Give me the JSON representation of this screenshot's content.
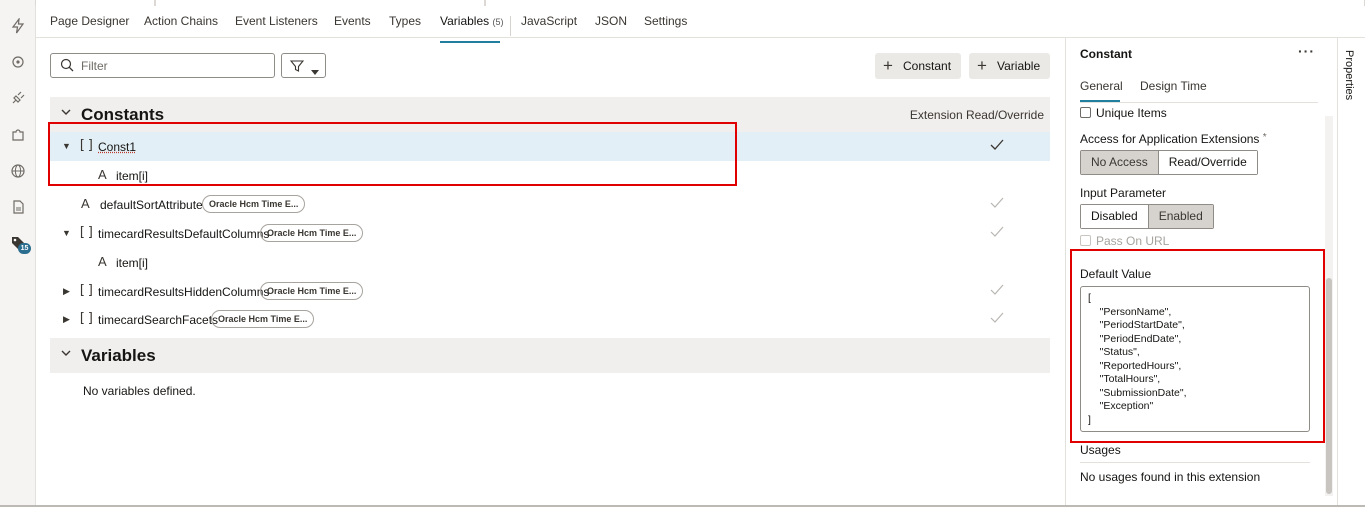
{
  "tabs": [
    {
      "label": "Page Designer"
    },
    {
      "label": "Action Chains"
    },
    {
      "label": "Event Listeners"
    },
    {
      "label": "Events"
    },
    {
      "label": "Types"
    },
    {
      "label": "Variables",
      "count": "(5)"
    },
    {
      "label": "JavaScript"
    },
    {
      "label": "JSON"
    },
    {
      "label": "Settings"
    }
  ],
  "toolbar": {
    "filter_placeholder": "Filter",
    "constant_button": "Constant",
    "variable_button": "Variable"
  },
  "constants_section": {
    "title": "Constants",
    "column_header": "Extension Read/Override",
    "rows": [
      {
        "name": "Const1",
        "type_icon": "array-icon",
        "expanded": true,
        "checked": true
      },
      {
        "name": "item[i]",
        "type_icon": "string-icon"
      },
      {
        "name": "defaultSortAttribute",
        "type_icon": "string-icon",
        "pill": "Oracle Hcm Time E...",
        "checked": true
      },
      {
        "name": "timecardResultsDefaultColumns",
        "type_icon": "array-icon",
        "expanded": true,
        "pill": "Oracle Hcm Time E...",
        "checked": true
      },
      {
        "name": "item[i]",
        "type_icon": "string-icon"
      },
      {
        "name": "timecardResultsHiddenColumns",
        "type_icon": "array-icon",
        "expanded": false,
        "pill": "Oracle Hcm Time E...",
        "checked": true
      },
      {
        "name": "timecardSearchFacets",
        "type_icon": "array-icon",
        "expanded": false,
        "pill": "Oracle Hcm Time E...",
        "checked": true
      }
    ]
  },
  "variables_section": {
    "title": "Variables",
    "empty_text": "No variables defined."
  },
  "properties": {
    "title": "Constant",
    "more": "···",
    "tabs": [
      "General",
      "Design Time"
    ],
    "unique_items_label": "Unique Items",
    "access_label": "Access for Application Extensions",
    "required_mark": "*",
    "access_options": [
      "No Access",
      "Read/Override"
    ],
    "access_selected": "No Access",
    "input_param_label": "Input Parameter",
    "input_param_options": [
      "Disabled",
      "Enabled"
    ],
    "input_param_selected": "Enabled",
    "pass_on_url_label": "Pass On URL",
    "default_value_label": "Default Value",
    "default_value_lines": [
      "[",
      "    \"PersonName\",",
      "    \"PeriodStartDate\",",
      "    \"PeriodEndDate\",",
      "    \"Status\",",
      "    \"ReportedHours\",",
      "    \"TotalHours\",",
      "    \"SubmissionDate\",",
      "    \"Exception\"",
      "]"
    ],
    "usages_label": "Usages",
    "usages_text": "No usages found in this extension"
  },
  "side_tab": "Properties",
  "left_rail_badge": "15",
  "colors": {
    "accent": "#227e9e",
    "highlight": "#e00000",
    "selected_row": "#e3eff6"
  }
}
